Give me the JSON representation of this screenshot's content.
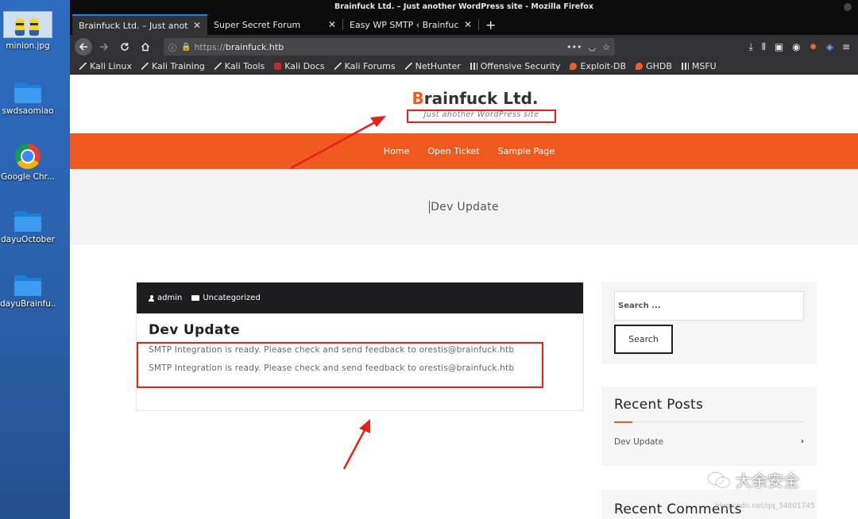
{
  "desktop": {
    "icons": [
      {
        "label": "minion.jpg"
      },
      {
        "label": "swdsaomiao"
      },
      {
        "label": "Google Chr..."
      },
      {
        "label": "dayuOctober"
      },
      {
        "label": "dayuBrainfu..."
      }
    ]
  },
  "window": {
    "title": "Brainfuck Ltd. – Just another WordPress site - Mozilla Firefox"
  },
  "tabs": [
    {
      "label": "Brainfuck Ltd. – Just another",
      "close": "✕"
    },
    {
      "label": "Super Secret Forum",
      "close": "✕"
    },
    {
      "label": "Easy WP SMTP ‹ Brainfuck L",
      "close": "✕"
    }
  ],
  "newtab": "+",
  "navbar": {
    "url_proto": "https://",
    "url_host": "brainfuck.htb",
    "more": "•••"
  },
  "bookmarks": [
    {
      "label": "Kali Linux",
      "icon": "kali-dragon-icon"
    },
    {
      "label": "Kali Training",
      "icon": "kali-dragon-icon"
    },
    {
      "label": "Kali Tools",
      "icon": "kali-dragon-icon"
    },
    {
      "label": "Kali Docs",
      "icon": "kali-docs-icon"
    },
    {
      "label": "Kali Forums",
      "icon": "kali-dragon-icon"
    },
    {
      "label": "NetHunter",
      "icon": "kali-dragon-icon"
    },
    {
      "label": "Offensive Security",
      "icon": "offsec-icon"
    },
    {
      "label": "Exploit-DB",
      "icon": "exploitdb-icon"
    },
    {
      "label": "GHDB",
      "icon": "exploitdb-icon"
    },
    {
      "label": "MSFU",
      "icon": "offsec-icon"
    }
  ],
  "site": {
    "title_first": "B",
    "title_rest": "rainfuck Ltd.",
    "tagline": "Just another WordPress site",
    "menu": [
      "Home",
      "Open Ticket",
      "Sample Page"
    ],
    "hero_title": "Dev Update",
    "accent_color": "#f05a1f"
  },
  "post": {
    "author": "admin",
    "category": "Uncategorized",
    "title": "Dev Update",
    "line1": "SMTP Integration is ready. Please check and send feedback to orestis@brainfuck.htb",
    "line2": "SMTP Integration is ready. Please check and send feedback to orestis@brainfuck.htb"
  },
  "sidebar": {
    "search_placeholder": "Search ...",
    "search_button": "Search",
    "recent_title": "Recent Posts",
    "recent_items": [
      "Dev Update"
    ],
    "recent_chevron": "›",
    "comments_title": "Recent Comments"
  },
  "watermark": {
    "text": "大余安全",
    "sub": "blog.csdn.net/qq_34801745"
  },
  "annotation_color": "#e8201a"
}
